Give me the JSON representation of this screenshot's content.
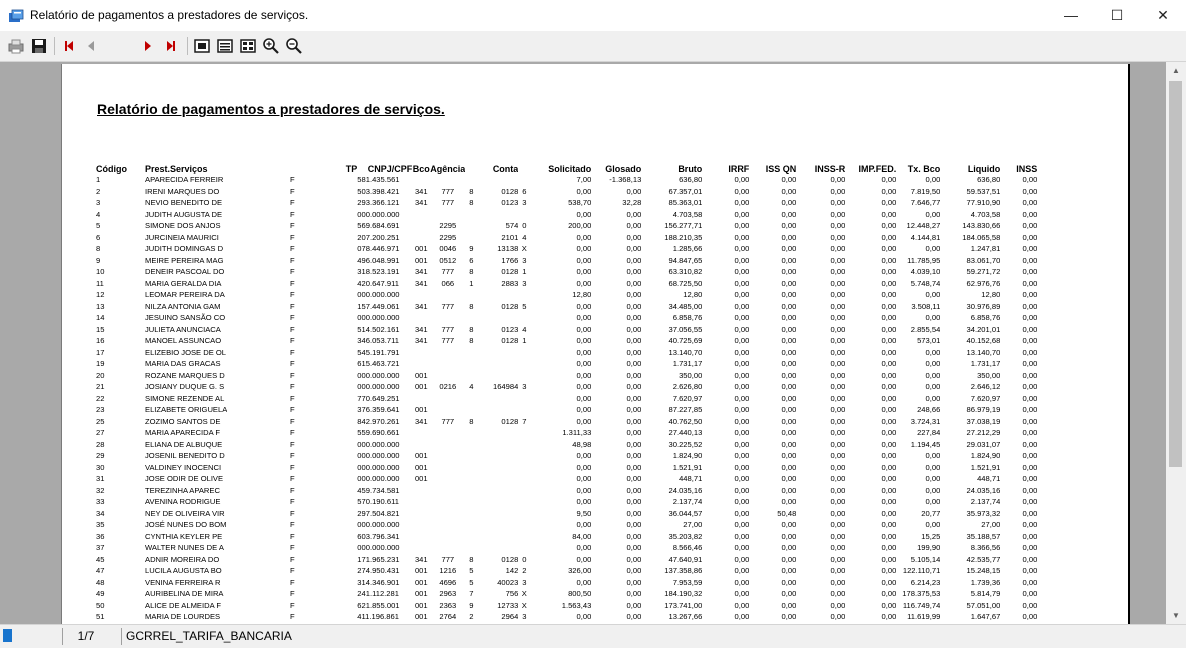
{
  "window": {
    "title": "Relatório de pagamentos a prestadores de serviços.",
    "minimize": "—",
    "maximize": "☐",
    "close": "✕"
  },
  "toolbar": {
    "page_value": "",
    "icons": [
      "printer-icon",
      "save-icon",
      "first-page-icon",
      "previous-page-icon",
      "next-page-icon",
      "last-page-icon",
      "whole-page-icon",
      "page-width-icon",
      "multi-page-icon",
      "zoom-in-icon",
      "zoom-out-icon"
    ]
  },
  "report": {
    "title": "Relatório de pagamentos a prestadores de serviços.",
    "columns": [
      "Código",
      "Prest.Serviços",
      "TP",
      "CNPJ/CPF",
      "Bco",
      "Agência",
      "",
      "Conta",
      "",
      "Solicitado",
      "Glosado",
      "Bruto",
      "IRRF",
      "ISS QN",
      "INSS-R",
      "IMP.FED.",
      "Tx. Bco",
      "Liquido",
      "INSS"
    ],
    "rows": [
      [
        "1",
        "APARECIDA FERREIR",
        "F",
        "581.435.561",
        "",
        "",
        "",
        "",
        "",
        "7,00",
        "-1.368,13",
        "636,80",
        "0,00",
        "0,00",
        "0,00",
        "0,00",
        "0,00",
        "636,80",
        "0,00"
      ],
      [
        "2",
        "IRENI MARQUES DO",
        "F",
        "503.398.421",
        "341",
        "777",
        "8",
        "0128",
        "6",
        "0,00",
        "0,00",
        "67.357,01",
        "0,00",
        "0,00",
        "0,00",
        "0,00",
        "7.819,50",
        "59.537,51",
        "0,00"
      ],
      [
        "3",
        "NEVIO BENEDITO DE",
        "F",
        "293.366.121",
        "341",
        "777",
        "8",
        "0123",
        "3",
        "538,70",
        "32,28",
        "85.363,01",
        "0,00",
        "0,00",
        "0,00",
        "0,00",
        "7.646,77",
        "77.910,90",
        "0,00"
      ],
      [
        "4",
        "JUDITH AUGUSTA DE",
        "F",
        "000.000.000",
        "",
        "",
        "",
        "",
        "",
        "0,00",
        "0,00",
        "4.703,58",
        "0,00",
        "0,00",
        "0,00",
        "0,00",
        "0,00",
        "4.703,58",
        "0,00"
      ],
      [
        "5",
        "SIMONE DOS ANJOS",
        "F",
        "569.684.691",
        "",
        "2295",
        "",
        "574",
        "0",
        "200,00",
        "0,00",
        "156.277,71",
        "0,00",
        "0,00",
        "0,00",
        "0,00",
        "12.448,27",
        "143.830,66",
        "0,00"
      ],
      [
        "6",
        "JURCINEIA MAURICI",
        "F",
        "207.200.251",
        "",
        "2295",
        "",
        "2101",
        "4",
        "0,00",
        "0,00",
        "188.210,35",
        "0,00",
        "0,00",
        "0,00",
        "0,00",
        "4.144,81",
        "184.065,58",
        "0,00"
      ],
      [
        "8",
        "JUDITH DOMINGAS D",
        "F",
        "078.446.971",
        "001",
        "0046",
        "9",
        "13138",
        "X",
        "0,00",
        "0,00",
        "1.285,66",
        "0,00",
        "0,00",
        "0,00",
        "0,00",
        "0,00",
        "1.247,81",
        "0,00"
      ],
      [
        "9",
        "MEIRE PEREIRA MAG",
        "F",
        "496.048.991",
        "001",
        "0512",
        "6",
        "1766",
        "3",
        "0,00",
        "0,00",
        "94.847,65",
        "0,00",
        "0,00",
        "0,00",
        "0,00",
        "11.785,95",
        "83.061,70",
        "0,00"
      ],
      [
        "10",
        "DENEIR PASCOAL DO",
        "F",
        "318.523.191",
        "341",
        "777",
        "8",
        "0128",
        "1",
        "0,00",
        "0,00",
        "63.310,82",
        "0,00",
        "0,00",
        "0,00",
        "0,00",
        "4.039,10",
        "59.271,72",
        "0,00"
      ],
      [
        "11",
        "MARIA GERALDA DIA",
        "F",
        "420.647.911",
        "341",
        "066",
        "1",
        "2883",
        "3",
        "0,00",
        "0,00",
        "68.725,50",
        "0,00",
        "0,00",
        "0,00",
        "0,00",
        "5.748,74",
        "62.976,76",
        "0,00"
      ],
      [
        "12",
        "LEOMAR PEREIRA DA",
        "F",
        "000.000.000",
        "",
        "",
        "",
        "",
        "",
        "12,80",
        "0,00",
        "12,80",
        "0,00",
        "0,00",
        "0,00",
        "0,00",
        "0,00",
        "12,80",
        "0,00"
      ],
      [
        "13",
        "NILZA ANTONIA GAM",
        "F",
        "157.449.061",
        "341",
        "777",
        "8",
        "0128",
        "5",
        "0,00",
        "0,00",
        "34.485,00",
        "0,00",
        "0,00",
        "0,00",
        "0,00",
        "3.508,11",
        "30.976,89",
        "0,00"
      ],
      [
        "14",
        "JESUINO SANSÃO CO",
        "F",
        "000.000.000",
        "",
        "",
        "",
        "",
        "",
        "0,00",
        "0,00",
        "6.858,76",
        "0,00",
        "0,00",
        "0,00",
        "0,00",
        "0,00",
        "6.858,76",
        "0,00"
      ],
      [
        "15",
        "JULIETA ANUNCIACA",
        "F",
        "514.502.161",
        "341",
        "777",
        "8",
        "0123",
        "4",
        "0,00",
        "0,00",
        "37.056,55",
        "0,00",
        "0,00",
        "0,00",
        "0,00",
        "2.855,54",
        "34.201,01",
        "0,00"
      ],
      [
        "16",
        "MANOEL ASSUNCAO",
        "F",
        "346.053.711",
        "341",
        "777",
        "8",
        "0128",
        "1",
        "0,00",
        "0,00",
        "40.725,69",
        "0,00",
        "0,00",
        "0,00",
        "0,00",
        "573,01",
        "40.152,68",
        "0,00"
      ],
      [
        "17",
        "ELIZEBIO JOSE DE OL",
        "F",
        "545.191.791",
        "",
        "",
        "",
        "",
        "",
        "0,00",
        "0,00",
        "13.140,70",
        "0,00",
        "0,00",
        "0,00",
        "0,00",
        "0,00",
        "13.140,70",
        "0,00"
      ],
      [
        "19",
        "MARIA DAS GRACAS",
        "F",
        "615.463.721",
        "",
        "",
        "",
        "",
        "",
        "0,00",
        "0,00",
        "1.731,17",
        "0,00",
        "0,00",
        "0,00",
        "0,00",
        "0,00",
        "1.731,17",
        "0,00"
      ],
      [
        "20",
        "ROZANE MARQUES D",
        "F",
        "000.000.000",
        "001",
        "",
        "",
        "",
        "",
        "0,00",
        "0,00",
        "350,00",
        "0,00",
        "0,00",
        "0,00",
        "0,00",
        "0,00",
        "350,00",
        "0,00"
      ],
      [
        "21",
        "JOSIANY DUQUE G. S",
        "F",
        "000.000.000",
        "001",
        "0216",
        "4",
        "164984",
        "3",
        "0,00",
        "0,00",
        "2.626,80",
        "0,00",
        "0,00",
        "0,00",
        "0,00",
        "0,00",
        "2.646,12",
        "0,00"
      ],
      [
        "22",
        "SIMONE REZENDE AL",
        "F",
        "770.649.251",
        "",
        "",
        "",
        "",
        "",
        "0,00",
        "0,00",
        "7.620,97",
        "0,00",
        "0,00",
        "0,00",
        "0,00",
        "0,00",
        "7.620,97",
        "0,00"
      ],
      [
        "23",
        "ELIZABETE ORIGUELA",
        "F",
        "376.359.641",
        "001",
        "",
        "",
        "",
        "",
        "0,00",
        "0,00",
        "87.227,85",
        "0,00",
        "0,00",
        "0,00",
        "0,00",
        "248,66",
        "86.979,19",
        "0,00"
      ],
      [
        "25",
        "ZOZIMO SANTOS DE",
        "F",
        "842.970.261",
        "341",
        "777",
        "8",
        "0128",
        "7",
        "0,00",
        "0,00",
        "40.762,50",
        "0,00",
        "0,00",
        "0,00",
        "0,00",
        "3.724,31",
        "37.038,19",
        "0,00"
      ],
      [
        "27",
        "MARIA APARECIDA F",
        "F",
        "559.690.661",
        "",
        "",
        "",
        "",
        "",
        "1.311,33",
        "0,00",
        "27.440,13",
        "0,00",
        "0,00",
        "0,00",
        "0,00",
        "227,84",
        "27.212,29",
        "0,00"
      ],
      [
        "28",
        "ELIANA DE ALBUQUE",
        "F",
        "000.000.000",
        "",
        "",
        "",
        "",
        "",
        "48,98",
        "0,00",
        "30.225,52",
        "0,00",
        "0,00",
        "0,00",
        "0,00",
        "1.194,45",
        "29.031,07",
        "0,00"
      ],
      [
        "29",
        "JOSENIL BENEDITO D",
        "F",
        "000.000.000",
        "001",
        "",
        "",
        "",
        "",
        "0,00",
        "0,00",
        "1.824,90",
        "0,00",
        "0,00",
        "0,00",
        "0,00",
        "0,00",
        "1.824,90",
        "0,00"
      ],
      [
        "30",
        "VALDINEY INOCENCI",
        "F",
        "000.000.000",
        "001",
        "",
        "",
        "",
        "",
        "0,00",
        "0,00",
        "1.521,91",
        "0,00",
        "0,00",
        "0,00",
        "0,00",
        "0,00",
        "1.521,91",
        "0,00"
      ],
      [
        "31",
        "JOSE ODIR DE OLIVE",
        "F",
        "000.000.000",
        "001",
        "",
        "",
        "",
        "",
        "0,00",
        "0,00",
        "448,71",
        "0,00",
        "0,00",
        "0,00",
        "0,00",
        "0,00",
        "448,71",
        "0,00"
      ],
      [
        "32",
        "TEREZINHA APAREC",
        "F",
        "459.734.581",
        "",
        "",
        "",
        "",
        "",
        "0,00",
        "0,00",
        "24.035,16",
        "0,00",
        "0,00",
        "0,00",
        "0,00",
        "0,00",
        "24.035,16",
        "0,00"
      ],
      [
        "33",
        "AVENINA RODRIGUE",
        "F",
        "570.190.611",
        "",
        "",
        "",
        "",
        "",
        "0,00",
        "0,00",
        "2.137,74",
        "0,00",
        "0,00",
        "0,00",
        "0,00",
        "0,00",
        "2.137,74",
        "0,00"
      ],
      [
        "34",
        "NEY DE OLIVEIRA VIR",
        "F",
        "297.504.821",
        "",
        "",
        "",
        "",
        "",
        "9,50",
        "0,00",
        "36.044,57",
        "0,00",
        "50,48",
        "0,00",
        "0,00",
        "20,77",
        "35.973,32",
        "0,00"
      ],
      [
        "35",
        "JOSÉ NUNES DO BOM",
        "F",
        "000.000.000",
        "",
        "",
        "",
        "",
        "",
        "0,00",
        "0,00",
        "27,00",
        "0,00",
        "0,00",
        "0,00",
        "0,00",
        "0,00",
        "27,00",
        "0,00"
      ],
      [
        "36",
        "CYNTHIA KEYLER PE",
        "F",
        "603.796.341",
        "",
        "",
        "",
        "",
        "",
        "84,00",
        "0,00",
        "35.203,82",
        "0,00",
        "0,00",
        "0,00",
        "0,00",
        "15,25",
        "35.188,57",
        "0,00"
      ],
      [
        "37",
        "WALTER NUNES DE A",
        "F",
        "000.000.000",
        "",
        "",
        "",
        "",
        "",
        "0,00",
        "0,00",
        "8.566,46",
        "0,00",
        "0,00",
        "0,00",
        "0,00",
        "199,90",
        "8.366,56",
        "0,00"
      ],
      [
        "45",
        "ADNIR MOREIRA DO",
        "F",
        "171.965.231",
        "341",
        "777",
        "8",
        "0128",
        "0",
        "0,00",
        "0,00",
        "47.640,91",
        "0,00",
        "0,00",
        "0,00",
        "0,00",
        "5.105,14",
        "42.535,77",
        "0,00"
      ],
      [
        "47",
        "LUCILA AUGUSTA BO",
        "F",
        "274.950.431",
        "001",
        "1216",
        "5",
        "142",
        "2",
        "326,00",
        "0,00",
        "137.358,86",
        "0,00",
        "0,00",
        "0,00",
        "0,00",
        "122.110,71",
        "15.248,15",
        "0,00"
      ],
      [
        "48",
        "VENINA FERREIRA R",
        "F",
        "314.346.901",
        "001",
        "4696",
        "5",
        "40023",
        "3",
        "0,00",
        "0,00",
        "7.953,59",
        "0,00",
        "0,00",
        "0,00",
        "0,00",
        "6.214,23",
        "1.739,36",
        "0,00"
      ],
      [
        "49",
        "AURIBELINA DE MIRA",
        "F",
        "241.112.281",
        "001",
        "2963",
        "7",
        "756",
        "X",
        "800,50",
        "0,00",
        "184.190,32",
        "0,00",
        "0,00",
        "0,00",
        "0,00",
        "178.375,53",
        "5.814,79",
        "0,00"
      ],
      [
        "50",
        "ALICE DE ALMEIDA F",
        "F",
        "621.855.001",
        "001",
        "2363",
        "9",
        "12733",
        "X",
        "1.563,43",
        "0,00",
        "173.741,00",
        "0,00",
        "0,00",
        "0,00",
        "0,00",
        "116.749,74",
        "57.051,00",
        "0,00"
      ],
      [
        "51",
        "MARIA DE LOURDES",
        "F",
        "411.196.861",
        "001",
        "2764",
        "2",
        "2964",
        "3",
        "0,00",
        "0,00",
        "13.267,66",
        "0,00",
        "0,00",
        "0,00",
        "0,00",
        "11.619,99",
        "1.647,67",
        "0,00"
      ]
    ]
  },
  "status": {
    "page": "1/7",
    "report_name": "GCRREL_TARIFA_BANCARIA"
  },
  "colors": {
    "toolbar_bg": "#f0f0f0",
    "viewport_bg": "#a9a9a9",
    "nav_arrow": "#c00000",
    "accent": "#1874cd"
  }
}
